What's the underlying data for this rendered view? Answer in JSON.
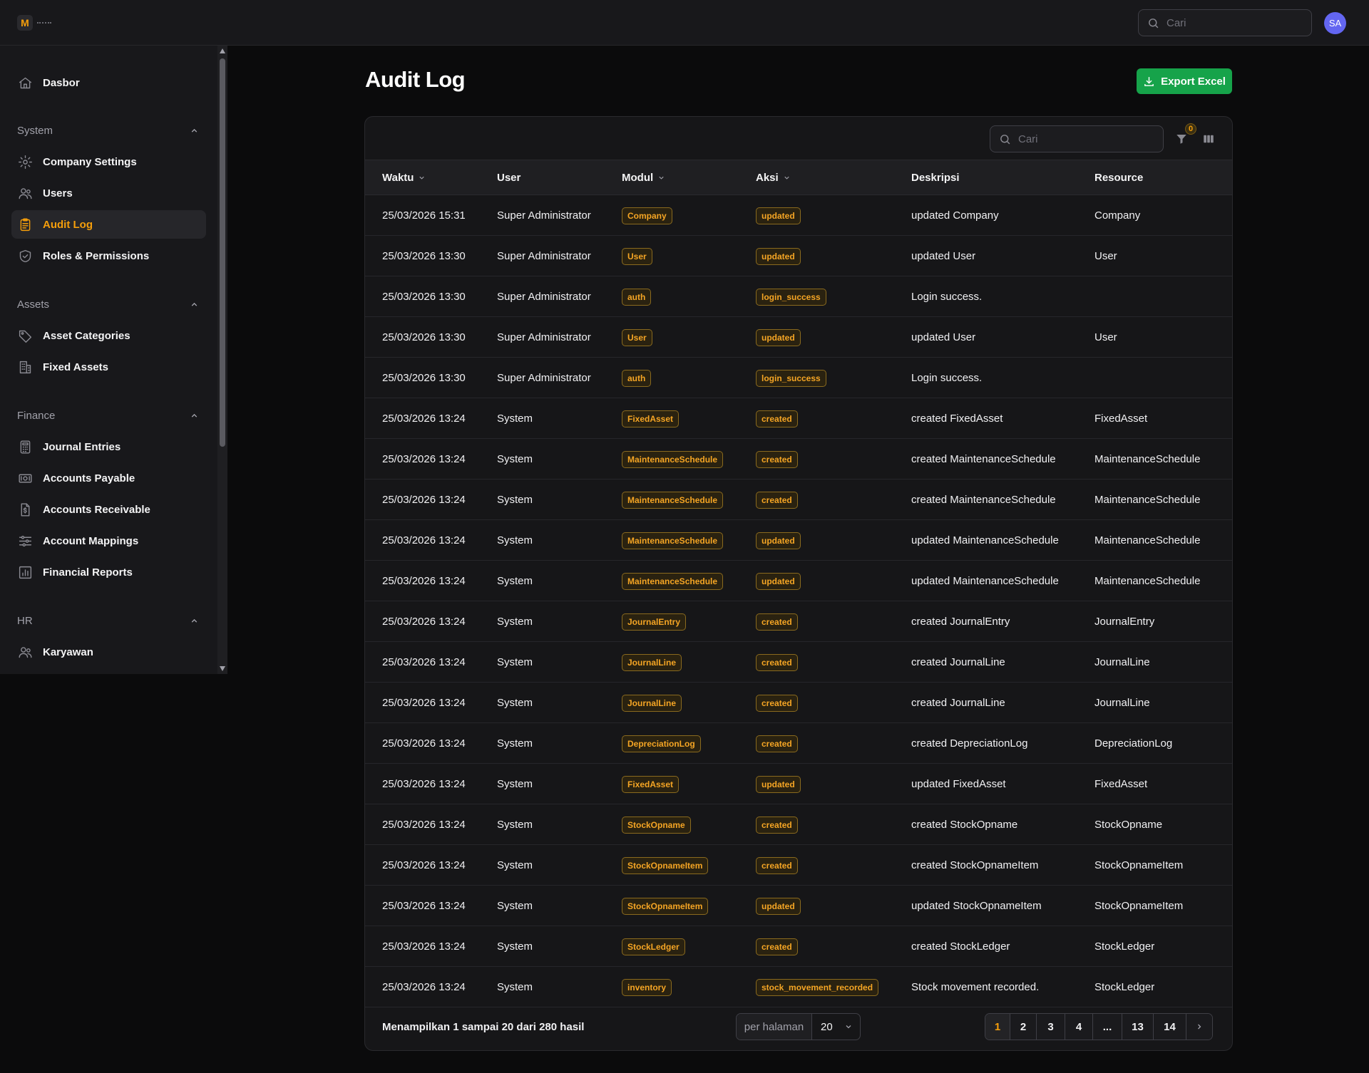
{
  "topbar": {
    "logo_letter": "M",
    "search_placeholder": "Cari",
    "avatar_initials": "SA"
  },
  "sidebar": {
    "top_item": {
      "label": "Dasbor",
      "icon": "home-icon"
    },
    "groups": [
      {
        "title": "System",
        "items": [
          {
            "label": "Company Settings",
            "icon": "gear-icon"
          },
          {
            "label": "Users",
            "icon": "users-icon"
          },
          {
            "label": "Audit Log",
            "icon": "clipboard-icon",
            "active": true
          },
          {
            "label": "Roles & Permissions",
            "icon": "shield-icon"
          }
        ]
      },
      {
        "title": "Assets",
        "items": [
          {
            "label": "Asset Categories",
            "icon": "tag-icon"
          },
          {
            "label": "Fixed Assets",
            "icon": "building-icon"
          }
        ]
      },
      {
        "title": "Finance",
        "items": [
          {
            "label": "Journal Entries",
            "icon": "calculator-icon"
          },
          {
            "label": "Accounts Payable",
            "icon": "cash-icon"
          },
          {
            "label": "Accounts Receivable",
            "icon": "document-dollar-icon"
          },
          {
            "label": "Account Mappings",
            "icon": "sliders-icon"
          },
          {
            "label": "Financial Reports",
            "icon": "bar-chart-icon"
          }
        ]
      },
      {
        "title": "HR",
        "items": [
          {
            "label": "Karyawan",
            "icon": "users-icon"
          }
        ]
      }
    ]
  },
  "main": {
    "title": "Audit Log",
    "export_label": "Export Excel",
    "table_search_placeholder": "Cari",
    "filter_count": "0",
    "columns": [
      "Waktu",
      "User",
      "Modul",
      "Aksi",
      "Deskripsi",
      "Resource"
    ],
    "rows": [
      [
        "25/03/2026 15:31",
        "Super Administrator",
        "Company",
        "updated",
        "updated Company",
        "Company"
      ],
      [
        "25/03/2026 13:30",
        "Super Administrator",
        "User",
        "updated",
        "updated User",
        "User"
      ],
      [
        "25/03/2026 13:30",
        "Super Administrator",
        "auth",
        "login_success",
        "Login success.",
        ""
      ],
      [
        "25/03/2026 13:30",
        "Super Administrator",
        "User",
        "updated",
        "updated User",
        "User"
      ],
      [
        "25/03/2026 13:30",
        "Super Administrator",
        "auth",
        "login_success",
        "Login success.",
        ""
      ],
      [
        "25/03/2026 13:24",
        "System",
        "FixedAsset",
        "created",
        "created FixedAsset",
        "FixedAsset"
      ],
      [
        "25/03/2026 13:24",
        "System",
        "MaintenanceSchedule",
        "created",
        "created MaintenanceSchedule",
        "MaintenanceSchedule"
      ],
      [
        "25/03/2026 13:24",
        "System",
        "MaintenanceSchedule",
        "created",
        "created MaintenanceSchedule",
        "MaintenanceSchedule"
      ],
      [
        "25/03/2026 13:24",
        "System",
        "MaintenanceSchedule",
        "updated",
        "updated MaintenanceSchedule",
        "MaintenanceSchedule"
      ],
      [
        "25/03/2026 13:24",
        "System",
        "MaintenanceSchedule",
        "updated",
        "updated MaintenanceSchedule",
        "MaintenanceSchedule"
      ],
      [
        "25/03/2026 13:24",
        "System",
        "JournalEntry",
        "created",
        "created JournalEntry",
        "JournalEntry"
      ],
      [
        "25/03/2026 13:24",
        "System",
        "JournalLine",
        "created",
        "created JournalLine",
        "JournalLine"
      ],
      [
        "25/03/2026 13:24",
        "System",
        "JournalLine",
        "created",
        "created JournalLine",
        "JournalLine"
      ],
      [
        "25/03/2026 13:24",
        "System",
        "DepreciationLog",
        "created",
        "created DepreciationLog",
        "DepreciationLog"
      ],
      [
        "25/03/2026 13:24",
        "System",
        "FixedAsset",
        "updated",
        "updated FixedAsset",
        "FixedAsset"
      ],
      [
        "25/03/2026 13:24",
        "System",
        "StockOpname",
        "created",
        "created StockOpname",
        "StockOpname"
      ],
      [
        "25/03/2026 13:24",
        "System",
        "StockOpnameItem",
        "created",
        "created StockOpnameItem",
        "StockOpnameItem"
      ],
      [
        "25/03/2026 13:24",
        "System",
        "StockOpnameItem",
        "updated",
        "updated StockOpnameItem",
        "StockOpnameItem"
      ],
      [
        "25/03/2026 13:24",
        "System",
        "StockLedger",
        "created",
        "created StockLedger",
        "StockLedger"
      ],
      [
        "25/03/2026 13:24",
        "System",
        "inventory",
        "stock_movement_recorded",
        "Stock movement recorded.",
        "StockLedger"
      ]
    ],
    "footer": {
      "summary": "Menampilkan 1 sampai 20 dari 280 hasil",
      "per_page_label": "per halaman",
      "per_page_value": "20",
      "pages": [
        "1",
        "2",
        "3",
        "4",
        "...",
        "13",
        "14"
      ],
      "current_page": "1"
    }
  },
  "colors": {
    "accent": "#f59e0b",
    "export_green": "#16a34a",
    "avatar": "#6366f1"
  }
}
